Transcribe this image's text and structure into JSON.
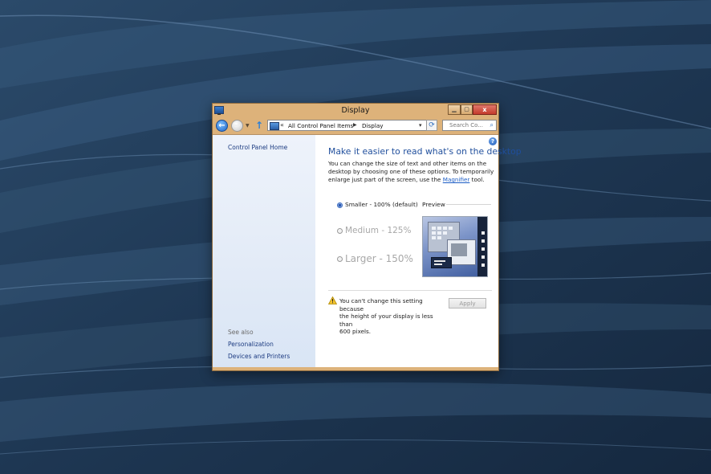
{
  "window": {
    "title": "Display",
    "minimize_glyph": "▁",
    "maximize_glyph": "▢",
    "close_glyph": "x"
  },
  "nav": {
    "back_glyph": "←",
    "forward_glyph": "→",
    "recent_glyph": "▼",
    "up_glyph": "↑",
    "address": {
      "chevron": "«",
      "crumbs": [
        "All Control Panel Items",
        "Display"
      ],
      "separator": "▶",
      "dropdown_glyph": "▾"
    },
    "refresh_glyph": "⟳",
    "search_placeholder": "Search Co...",
    "search_glyph": "⌕"
  },
  "sidebar": {
    "home_link": "Control Panel Home",
    "see_also_label": "See also",
    "links": [
      "Personalization",
      "Devices and Printers"
    ]
  },
  "main": {
    "help_glyph": "?",
    "heading": "Make it easier to read what's on the desktop",
    "description_line1": "You can change the size of text and other items on the",
    "description_line2": "desktop by choosing one of these options. To temporarily",
    "description_line3_prefix": "enlarge just part of the screen, use the ",
    "description_link": "Magnifier",
    "description_line3_suffix": " tool.",
    "options": [
      {
        "label": "Smaller - 100% (default)",
        "selected": true,
        "enabled": true
      },
      {
        "label": "Medium - 125%",
        "selected": false,
        "enabled": false
      },
      {
        "label": "Larger - 150%",
        "selected": false,
        "enabled": false
      }
    ],
    "preview_label": "Preview",
    "warning_line1": "You can't change this setting because",
    "warning_line2": "the height of your display is less than",
    "warning_line3": "600 pixels.",
    "apply_label": "Apply",
    "apply_enabled": false
  },
  "colors": {
    "window_frame": "#ddb27a",
    "heading": "#1f4e9c",
    "link": "#1b3a80",
    "desktop": "#1f3650"
  },
  "icons": {
    "app": "display-app-icon",
    "warning": "warning-icon",
    "help": "help-icon"
  }
}
